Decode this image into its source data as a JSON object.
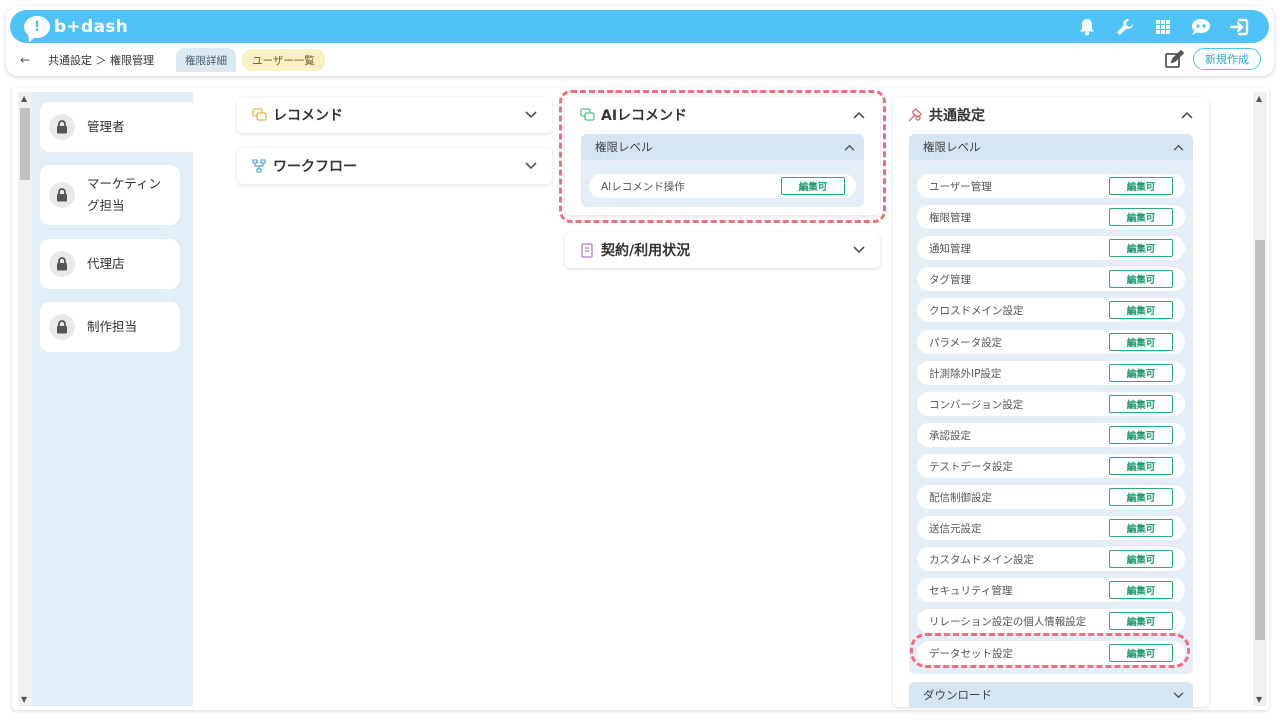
{
  "app": {
    "logo_mark": "!",
    "logo_text": "b+dash"
  },
  "topbar": {
    "icons": [
      "bell-icon",
      "wrench-icon",
      "grid-icon",
      "chat-robot-icon",
      "logout-icon"
    ]
  },
  "subbar": {
    "back": "←",
    "breadcrumb": "共通設定 ＞ 権限管理",
    "tab_detail": "権限詳細",
    "tab_users": "ユーザー一覧",
    "new_button": "新規作成"
  },
  "roles": [
    {
      "label": "管理者"
    },
    {
      "label": "マーケティング担当"
    },
    {
      "label": "代理店"
    },
    {
      "label": "制作担当"
    }
  ],
  "cards": {
    "recommend": {
      "title": "レコメンド"
    },
    "workflow": {
      "title": "ワークフロー"
    },
    "ai_recommend": {
      "title": "AIレコメンド",
      "level_label": "権限レベル",
      "rows": [
        {
          "label": "AIレコメンド操作",
          "status": "編集可"
        }
      ]
    },
    "contract": {
      "title": "契約/利用状況"
    },
    "common": {
      "title": "共通設定",
      "level_label": "権限レベル",
      "rows": [
        {
          "label": "ユーザー管理",
          "status": "編集可"
        },
        {
          "label": "権限管理",
          "status": "編集可"
        },
        {
          "label": "通知管理",
          "status": "編集可"
        },
        {
          "label": "タグ管理",
          "status": "編集可"
        },
        {
          "label": "クロスドメイン設定",
          "status": "編集可"
        },
        {
          "label": "パラメータ設定",
          "status": "編集可"
        },
        {
          "label": "計測除外IP設定",
          "status": "編集可"
        },
        {
          "label": "コンバージョン設定",
          "status": "編集可"
        },
        {
          "label": "承認設定",
          "status": "編集可"
        },
        {
          "label": "テストデータ設定",
          "status": "編集可"
        },
        {
          "label": "配信制御設定",
          "status": "編集可"
        },
        {
          "label": "送信元設定",
          "status": "編集可"
        },
        {
          "label": "カスタムドメイン設定",
          "status": "編集可"
        },
        {
          "label": "セキュリティ管理",
          "status": "編集可"
        },
        {
          "label": "リレーション設定の個人情報設定",
          "status": "編集可"
        },
        {
          "label": "データセット設定",
          "status": "編集可"
        }
      ],
      "download_label": "ダウンロード"
    }
  },
  "colors": {
    "accent": "#4fc3f7",
    "badge": "#27ae79",
    "highlight": "#ef6f7e",
    "sidebar": "#e2eef8"
  }
}
